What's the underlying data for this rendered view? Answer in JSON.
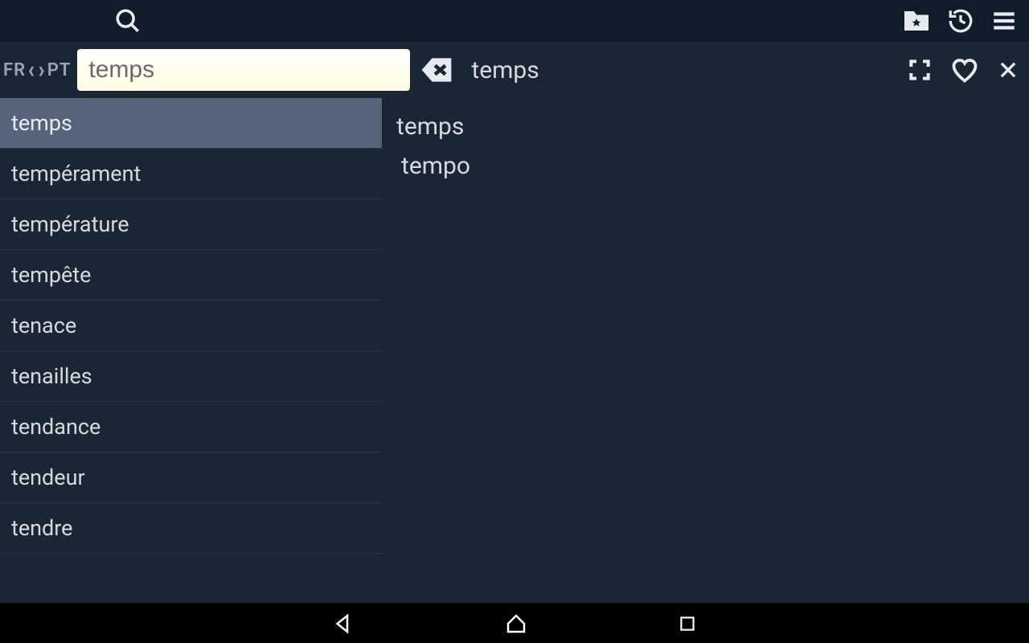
{
  "header": {
    "icons": {
      "search": "search",
      "favorites_folder": "favorites-folder",
      "history": "history",
      "menu": "menu"
    }
  },
  "language_switch": {
    "from": "FR",
    "to": "PT"
  },
  "search": {
    "value": "temps",
    "placeholder": ""
  },
  "detail_header": {
    "title": "temps",
    "icons": {
      "fullscreen": "fullscreen",
      "favorite": "favorite",
      "close": "close"
    }
  },
  "word_list": [
    {
      "word": "temps",
      "selected": true
    },
    {
      "word": "tempérament",
      "selected": false
    },
    {
      "word": "température",
      "selected": false
    },
    {
      "word": "tempête",
      "selected": false
    },
    {
      "word": "tenace",
      "selected": false
    },
    {
      "word": "tenailles",
      "selected": false
    },
    {
      "word": "tendance",
      "selected": false
    },
    {
      "word": "tendeur",
      "selected": false
    },
    {
      "word": "tendre",
      "selected": false
    }
  ],
  "detail": {
    "headword": "temps",
    "translations": [
      "tempo"
    ]
  },
  "navbar": {
    "back": "back",
    "home": "home",
    "recent": "recent"
  }
}
